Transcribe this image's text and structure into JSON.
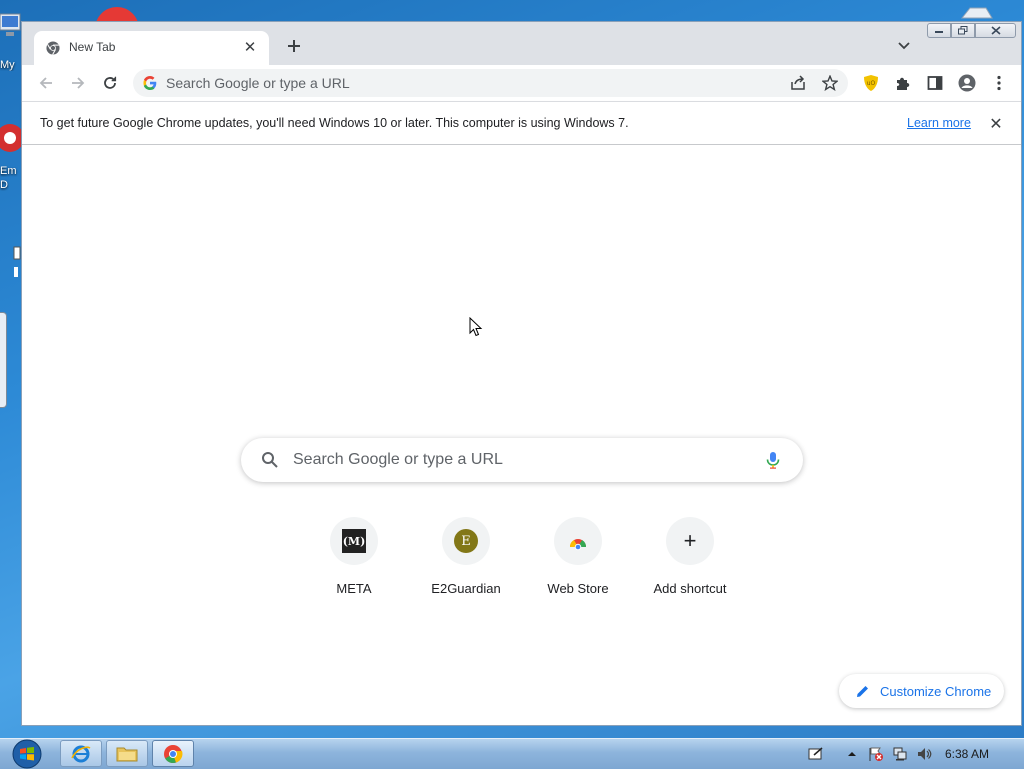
{
  "desktop": {
    "icon_labels": [
      "My",
      "Em",
      "D"
    ]
  },
  "tab": {
    "title": "New Tab"
  },
  "omnibox": {
    "placeholder": "Search Google or type a URL"
  },
  "infobar": {
    "message": "To get future Google Chrome updates, you'll need Windows 10 or later. This computer is using Windows 7.",
    "link_label": "Learn more"
  },
  "ntp": {
    "search_placeholder": "Search Google or type a URL",
    "shortcuts": [
      {
        "label": "META",
        "icon": "meta-icon",
        "glyph": "(M)"
      },
      {
        "label": "E2Guardian",
        "icon": "e2guardian-icon",
        "glyph": "E"
      },
      {
        "label": "Web Store",
        "icon": "webstore-icon",
        "glyph": ""
      },
      {
        "label": "Add shortcut",
        "icon": "plus-icon",
        "glyph": "+"
      }
    ],
    "customize_label": "Customize Chrome"
  },
  "taskbar": {
    "clock": "6:38 AM"
  },
  "colors": {
    "accent": "#1a73e8",
    "tabstrip": "#dee1e6",
    "omnibox_bg": "#f1f3f4",
    "e2guardian_icon": "#827717"
  }
}
